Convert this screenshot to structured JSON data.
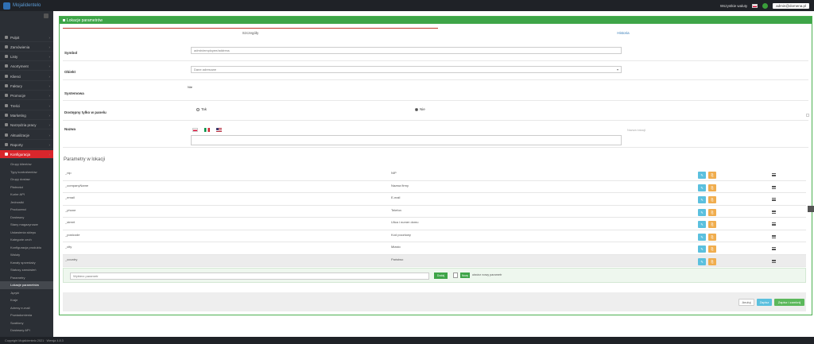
{
  "topbar": {
    "logo_text": "Mojalidentelo",
    "currency": "Wszystkie waluty",
    "user_label": "admin@domena.pl"
  },
  "sidebar": {
    "items": [
      {
        "label": "Pulpit",
        "icon": "home-icon"
      },
      {
        "label": "Zamówienia",
        "icon": "cart-icon"
      },
      {
        "label": "Listy",
        "icon": "list-icon"
      },
      {
        "label": "Asortyment",
        "icon": "box-icon"
      },
      {
        "label": "Klienci",
        "icon": "users-icon"
      },
      {
        "label": "Faktury",
        "icon": "invoice-icon"
      },
      {
        "label": "Promocje",
        "icon": "tag-icon"
      },
      {
        "label": "Treści",
        "icon": "text-icon"
      },
      {
        "label": "Marketing",
        "icon": "megaphone-icon"
      },
      {
        "label": "Narzędzia pracy",
        "icon": "wrench-icon"
      },
      {
        "label": "Aktualizacje",
        "icon": "refresh-icon"
      },
      {
        "label": "Raporty",
        "icon": "chart-icon"
      },
      {
        "label": "Konfiguracja",
        "icon": "gear-icon"
      }
    ],
    "sub_items": [
      "Grupy klientów",
      "Typy kontrahentów",
      "Grupy dostaw",
      "Płatności",
      "Kurier API",
      "Jednostki",
      "Producenci",
      "Dostawcy",
      "Stany magazynowe",
      "Ustawienia sklepu",
      "Kategorie cech",
      "Konfiguracja produktu",
      "Waluty",
      "Kanały sprzedaży",
      "Statusy zamówień",
      "Parametry",
      "Lokacje parametrów",
      "Języki",
      "Kraje",
      "Adresy e-mail",
      "Powiadomienia",
      "Szablony",
      "Dostawcy API"
    ],
    "active_sub_index": 16
  },
  "panel": {
    "title": "Lokacje parametrów",
    "tabs": [
      "Szczegóły",
      "Historia"
    ],
    "form": {
      "symbol_label": "Symbol",
      "symbol_value": "admin/employee/address",
      "object_label": "Obiekt",
      "object_value": "Dane adresowe",
      "system_label": "Systemowa",
      "system_value": "Nie",
      "panel_only_label": "Dostępny tylko w panelu",
      "panel_only_yes": "Tak",
      "panel_only_no": "Nie",
      "panel_only_selected": "Nie",
      "name_label": "Nazwa",
      "name_hint": "Nazwa lokacji"
    },
    "params_title": "Parametry w lokacji",
    "params": [
      {
        "key": "_nip",
        "value": "NIP"
      },
      {
        "key": "_companyName",
        "value": "Nazwa firmy"
      },
      {
        "key": "_email",
        "value": "E-mail"
      },
      {
        "key": "_phone",
        "value": "Telefon"
      },
      {
        "key": "_street",
        "value": "Ulica i numer domu"
      },
      {
        "key": "_postcode",
        "value": "Kod pocztowy"
      },
      {
        "key": "_city",
        "value": "Miasto"
      },
      {
        "key": "_country",
        "value": "Państwo"
      }
    ],
    "add_placeholder": "Wybierz parametr",
    "add_button": "Dodaj",
    "new_badge": "Nowy",
    "new_text": "utwórz nowy parametr",
    "actions": {
      "cancel": "Anuluj",
      "save": "Zapisz",
      "save_close": "Zapisz i zamknij"
    }
  },
  "footer": {
    "text": "Copyright Mojalidentelo 2021 · Wersja 4.8.3"
  },
  "colors": {
    "accent_green": "#3ea548",
    "sidebar_active": "#d9262c",
    "edit_button": "#5bc0de",
    "copy_button": "#f0ad4e"
  }
}
